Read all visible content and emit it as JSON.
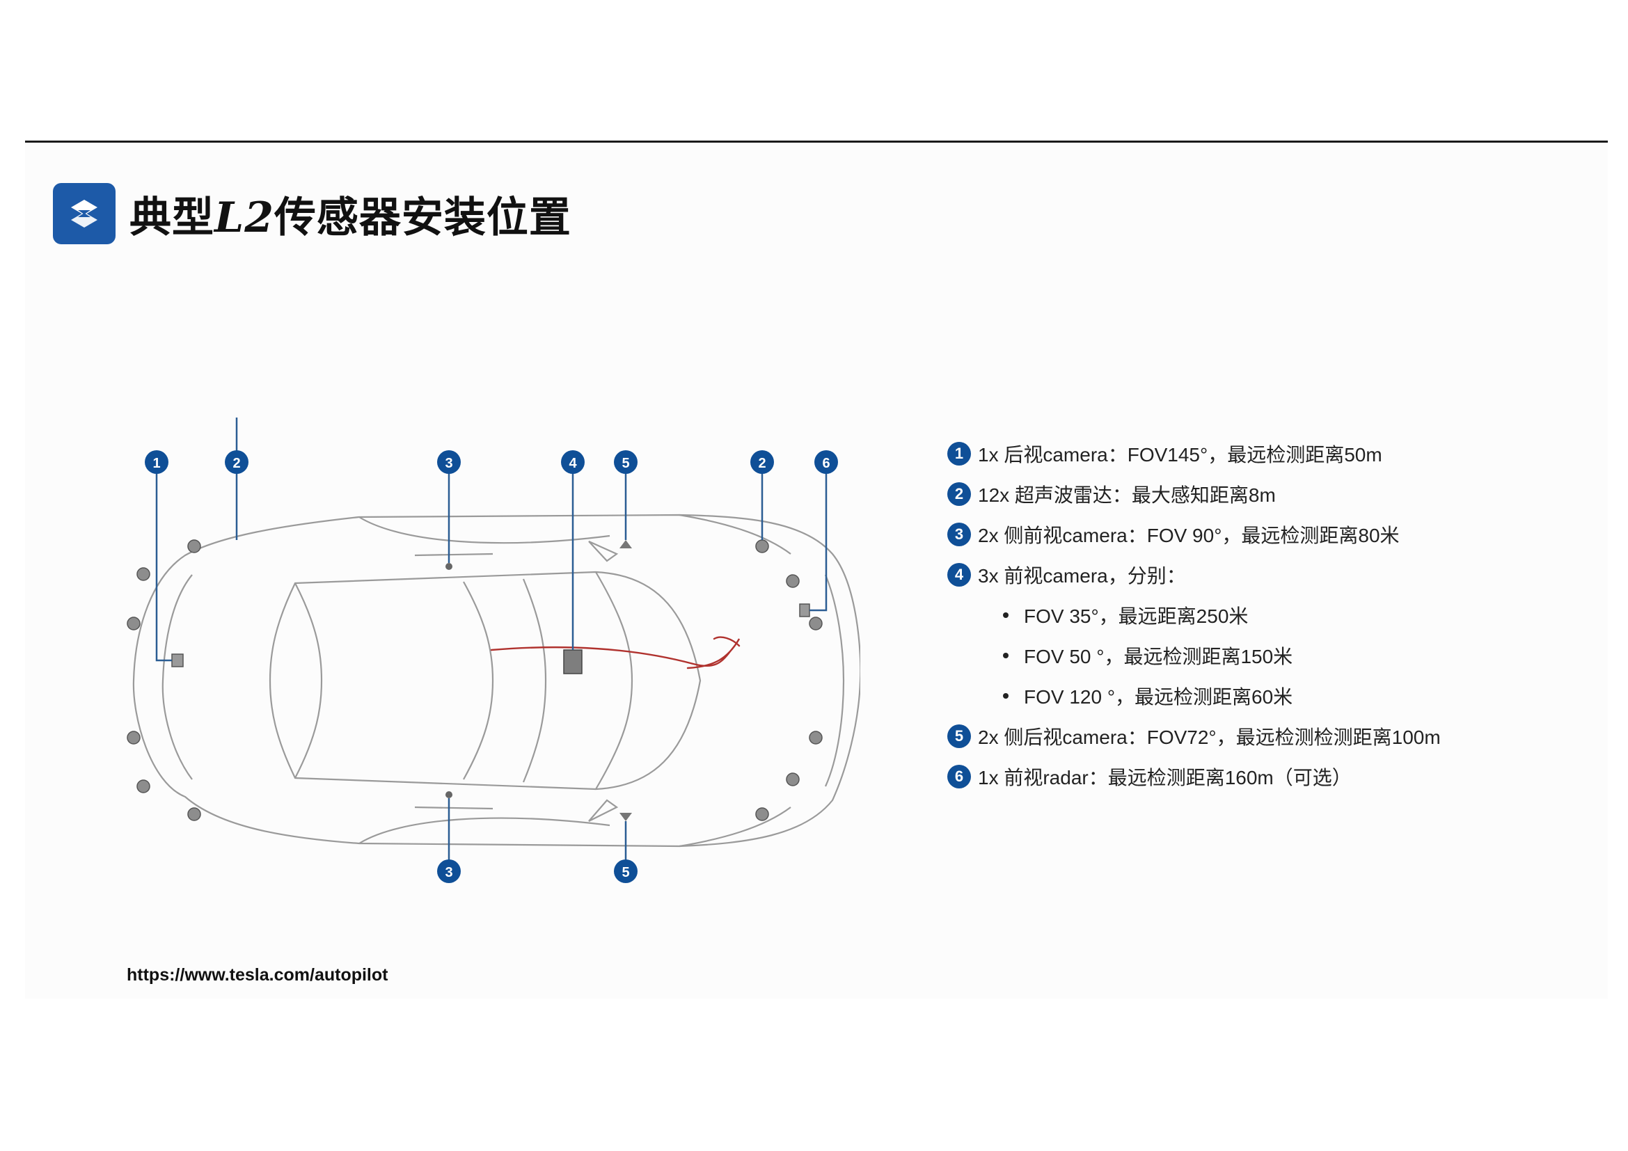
{
  "title": {
    "part1": "典型",
    "part2": "L2",
    "part3": "传感器安装位置"
  },
  "markers": {
    "m1": "1",
    "m2": "2",
    "m3": "3",
    "m4": "4",
    "m5": "5",
    "m6": "6"
  },
  "legend": [
    {
      "badge": "1",
      "text": "1x 后视camera：FOV145°，最远检测距离50m"
    },
    {
      "badge": "2",
      "text": "12x 超声波雷达：最大感知距离8m"
    },
    {
      "badge": "3",
      "text": "2x 侧前视camera：FOV 90°，最远检测距离80米"
    },
    {
      "badge": "4",
      "text": "3x 前视camera，分别："
    },
    {
      "badge": "5",
      "text": "2x 侧后视camera：FOV72°，最远检测检测距离100m"
    },
    {
      "badge": "6",
      "text": "1x 前视radar：最远检测距离160m（可选）"
    }
  ],
  "front_cameras": [
    "FOV 35°，最远距离250米",
    "FOV 50 °，最远检测距离150米",
    "FOV 120 °，最远检测距离60米"
  ],
  "source": "https://www.tesla.com/autopilot",
  "colors": {
    "badge": "#0f4f97",
    "logo": "#1d5aa8",
    "annotation": "#b0322e"
  }
}
